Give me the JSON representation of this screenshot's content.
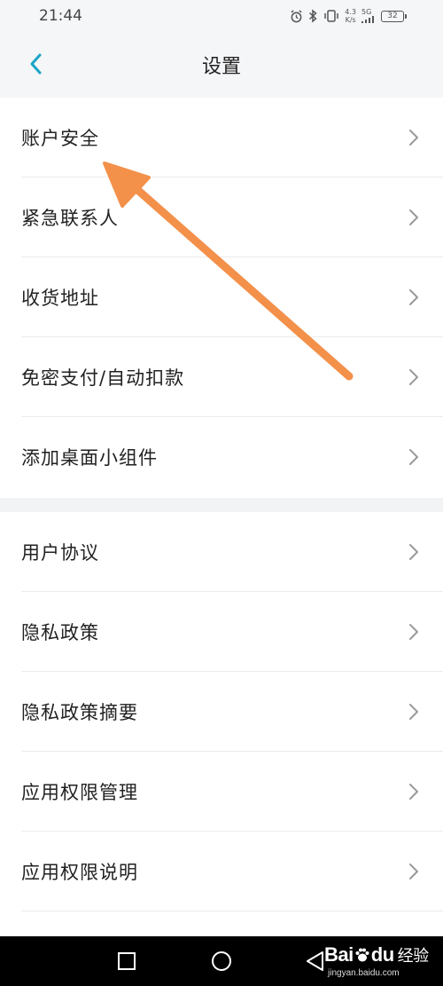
{
  "status_bar": {
    "time": "21:44",
    "speed_value": "4.3",
    "speed_unit": "K/s",
    "network": "5G",
    "battery": "32",
    "icons": [
      "alarm-icon",
      "bluetooth-icon",
      "vibrate-icon",
      "signal-icon",
      "battery-icon"
    ]
  },
  "header": {
    "title": "设置",
    "back_icon": "chevron-left-icon"
  },
  "groups": [
    {
      "items": [
        {
          "label": "账户安全"
        },
        {
          "label": "紧急联系人"
        },
        {
          "label": "收货地址"
        },
        {
          "label": "免密支付/自动扣款"
        },
        {
          "label": "添加桌面小组件"
        }
      ]
    },
    {
      "items": [
        {
          "label": "用户协议"
        },
        {
          "label": "隐私政策"
        },
        {
          "label": "隐私政策摘要"
        },
        {
          "label": "应用权限管理"
        },
        {
          "label": "应用权限说明"
        }
      ]
    }
  ],
  "colors": {
    "accent": "#1aa3c6",
    "arrow": "#f3904a",
    "background": "#f2f3f5",
    "card": "#ffffff"
  },
  "watermark": {
    "brand_left": "Bai",
    "brand_right": "du",
    "brand_sub": "经验",
    "url": "jingyan.baidu.com"
  }
}
